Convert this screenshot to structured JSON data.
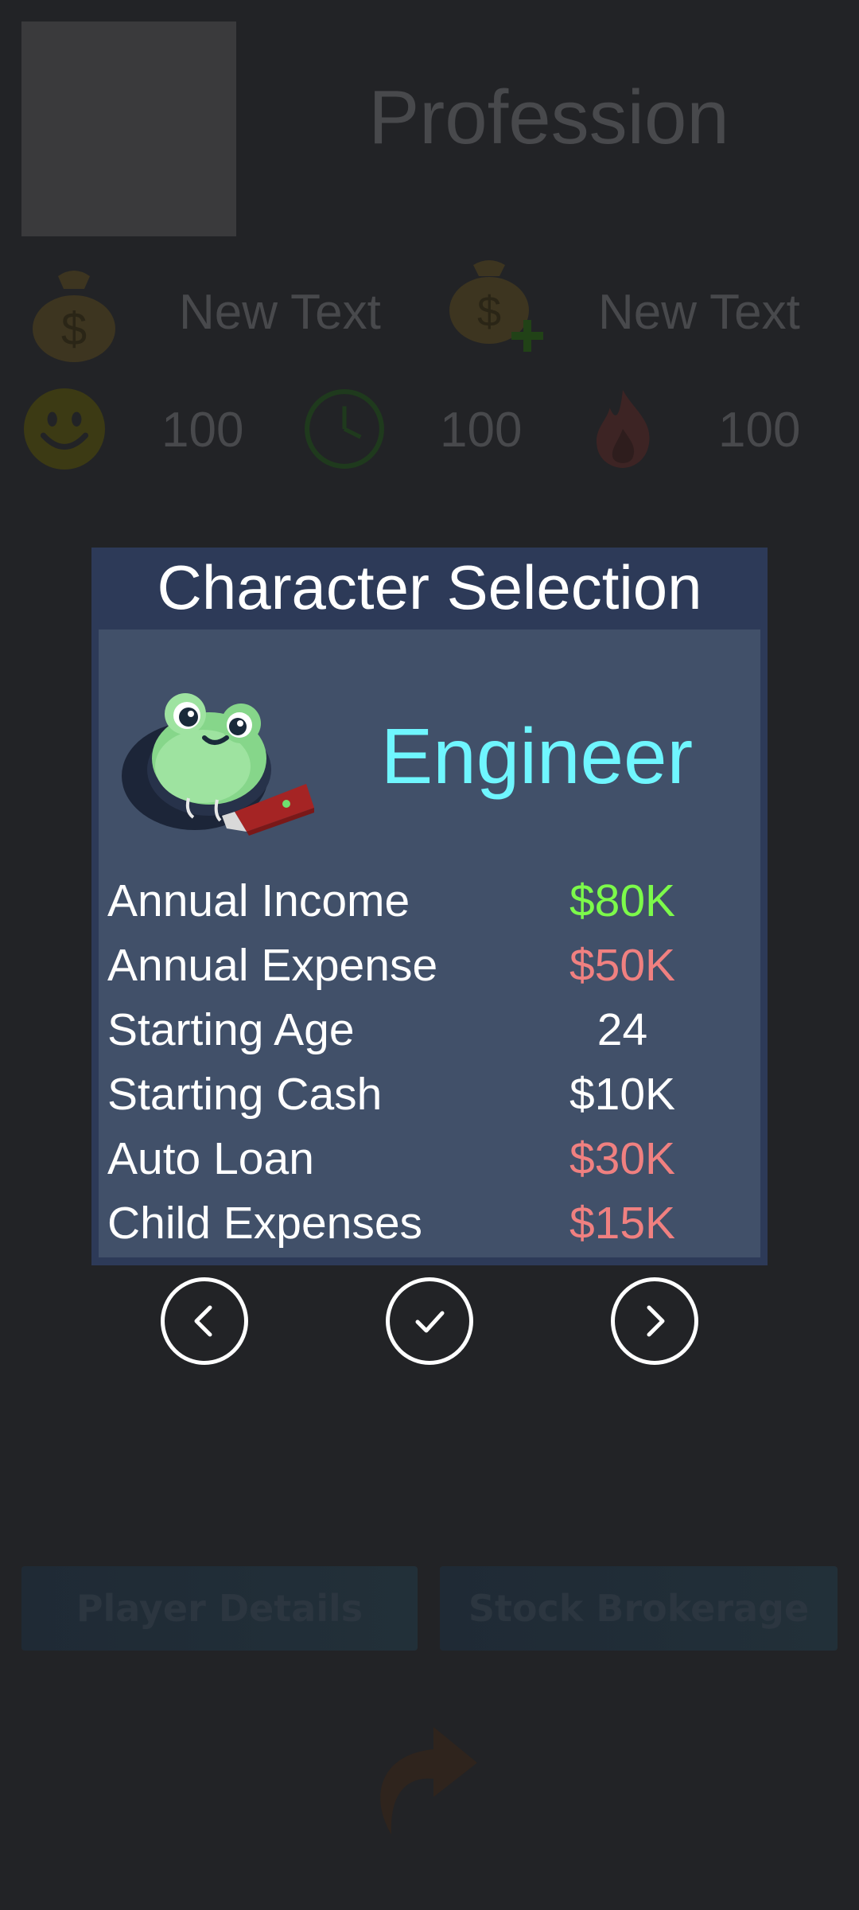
{
  "background": {
    "profession_title": "Profession",
    "income_text": "New Text",
    "extra_income_text": "New Text",
    "happiness_value": "100",
    "time_value": "100",
    "burnout_value": "100",
    "buttons": {
      "player_details": "Player Details",
      "stock_brokerage": "Stock Brokerage"
    }
  },
  "modal": {
    "title": "Character Selection",
    "profession": "Engineer",
    "character_icon": "frog-with-laptop-icon",
    "stats": [
      {
        "label": "Annual Income",
        "value": "$80K",
        "color": "#7cfa4a"
      },
      {
        "label": "Annual Expense",
        "value": "$50K",
        "color": "#f08080"
      },
      {
        "label": "Starting Age",
        "value": "24",
        "color": "#ffffff"
      },
      {
        "label": "Starting Cash",
        "value": "$10K",
        "color": "#ffffff"
      },
      {
        "label": "Auto Loan",
        "value": "$30K",
        "color": "#f08080"
      },
      {
        "label": "Child Expenses",
        "value": "$15K",
        "color": "#f08080"
      }
    ],
    "nav": {
      "prev_icon": "chevron-left-icon",
      "confirm_icon": "checkmark-icon",
      "next_icon": "chevron-right-icon"
    }
  },
  "colors": {
    "modal_header": "#2d3a58",
    "modal_panel": "#415069",
    "profession_accent": "#6ff6ff"
  }
}
